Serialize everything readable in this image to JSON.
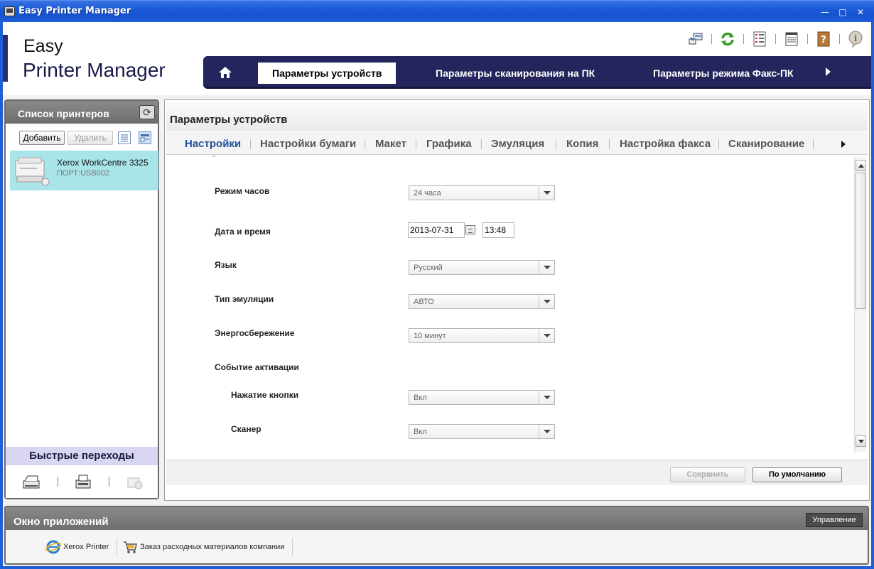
{
  "window": {
    "title": "Easy Printer Manager",
    "controls": [
      "minimize",
      "maximize",
      "close"
    ]
  },
  "header": {
    "logo_line1": "Easy",
    "logo_line2": "Printer Manager",
    "toolbar_icons": [
      "printer-connect-icon",
      "refresh-icon",
      "list-view-icon",
      "table-view-icon",
      "help-book-icon",
      "info-icon"
    ],
    "nav": {
      "home_icon": "home-icon",
      "tabs": [
        "Параметры устройств",
        "Параметры сканирования на ПК",
        "Параметры режима Факс-ПК"
      ],
      "active_tab": 0
    }
  },
  "sidebar": {
    "title": "Список принтеров",
    "add_button": "Добавить",
    "delete_button": "Удалить",
    "printers": [
      {
        "name": "Xerox WorkCentre 3325",
        "port": "ПОРТ:USB002"
      }
    ],
    "quick_jump_title": "Быстрые переходы",
    "quick_icons": [
      "scanner-icon",
      "fax-icon",
      "settings-icon"
    ]
  },
  "main": {
    "title": "Параметры устройств",
    "tabs": [
      "Настройки",
      "Настройки бумаги",
      "Макет",
      "Графика",
      "Эмуляция",
      "Копия",
      "Настройка факса",
      "Сканирование"
    ],
    "active_tab": 0,
    "fields": {
      "clock_mode": {
        "label": "Режим часов",
        "value": "24 часа"
      },
      "datetime": {
        "label": "Дата и время",
        "date": "2013-07-31",
        "time": "13:48"
      },
      "language": {
        "label": "Язык",
        "value": "Русский"
      },
      "emulation_type": {
        "label": "Тип эмуляции",
        "value": "АВТО"
      },
      "power_save": {
        "label": "Энергосбережение",
        "value": "10 минут"
      },
      "wakeup_event": {
        "label": "Событие активации"
      },
      "button_press": {
        "label": "Нажатие кнопки",
        "value": "Вкл"
      },
      "scanner": {
        "label": "Сканер",
        "value": "Вкл"
      }
    },
    "save_button": "Сохранить",
    "default_button": "По умолчанию"
  },
  "apps": {
    "title": "Окно приложений",
    "manage_button": "Управление",
    "items": [
      {
        "label": "Xerox Printer",
        "icon": "ie-icon"
      },
      {
        "label": "Заказ расходных материалов компании",
        "icon": "cart-icon"
      }
    ]
  },
  "colors": {
    "titlebar": "#1f5fd8",
    "nav_bg": "#23255c",
    "selected_printer": "#a9e4e8",
    "active_subtab": "#1e4e9a"
  }
}
